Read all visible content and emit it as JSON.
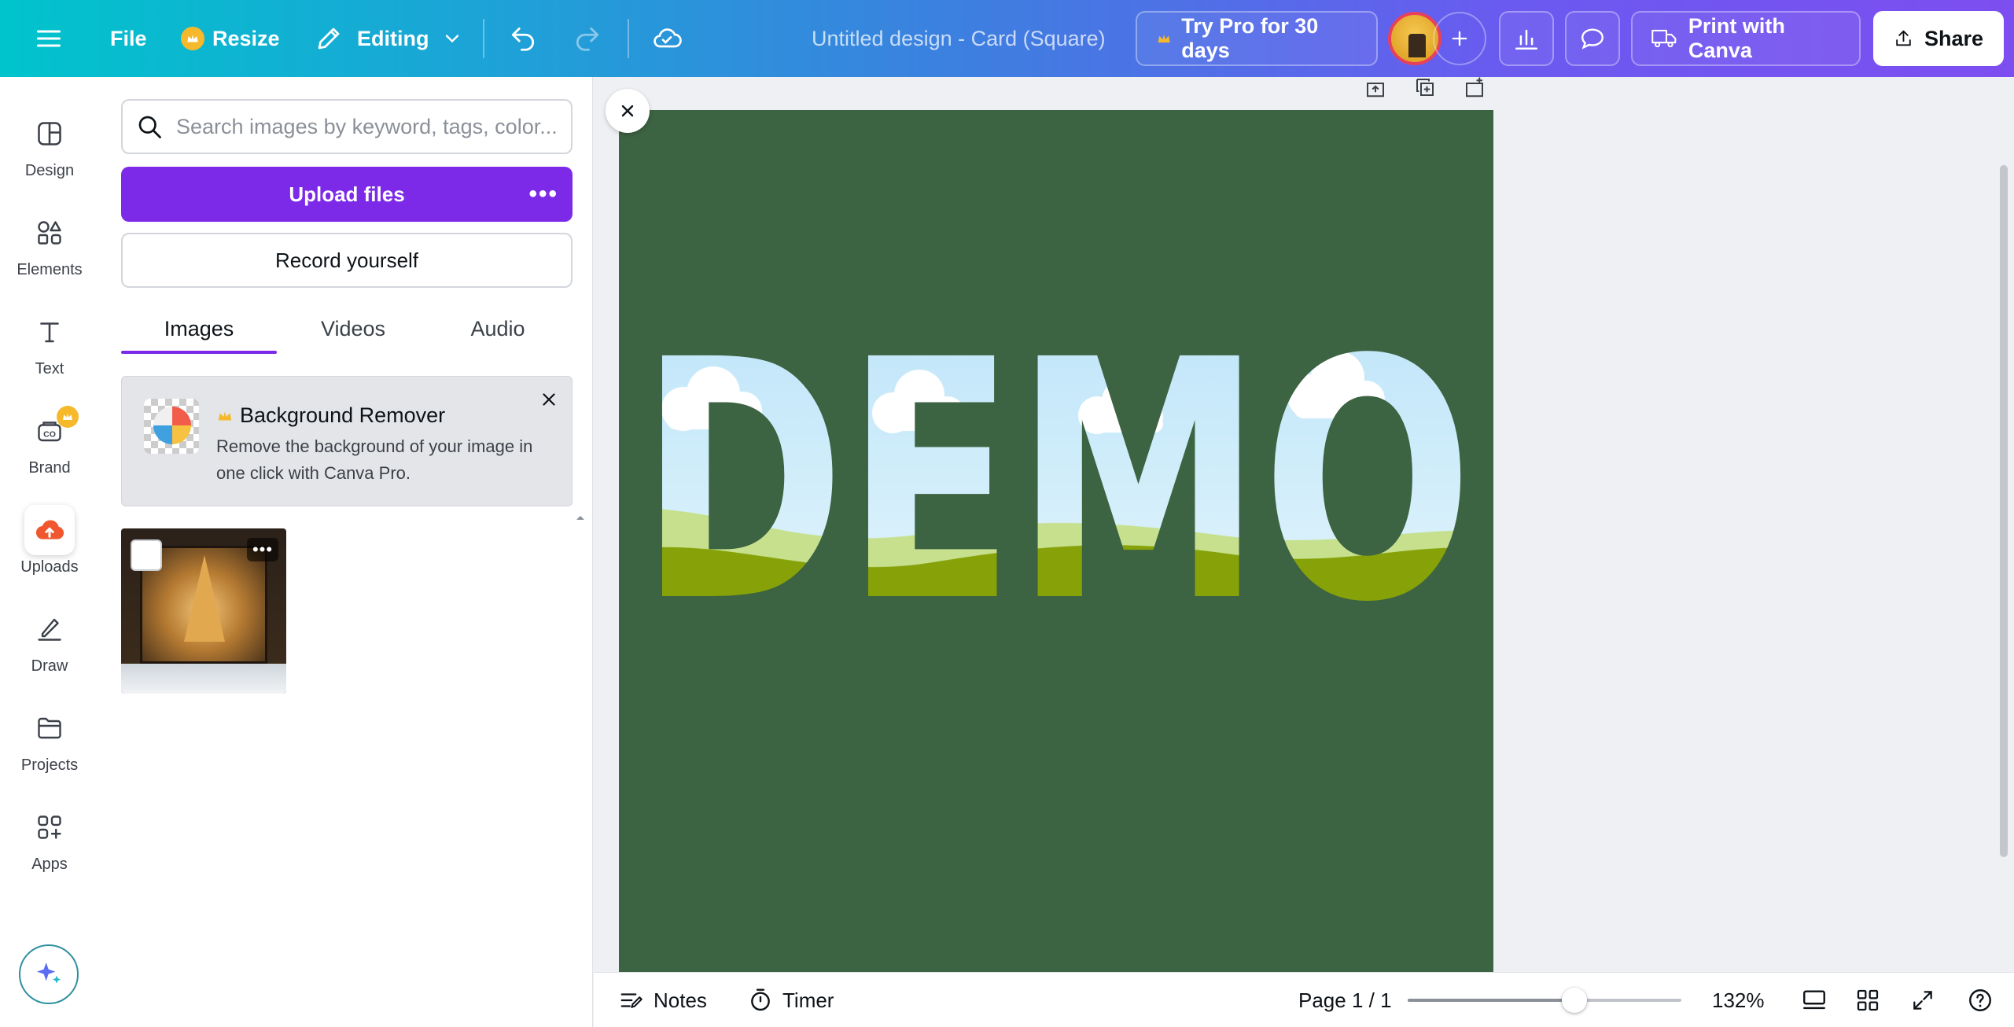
{
  "topbar": {
    "file_label": "File",
    "resize_label": "Resize",
    "editing_label": "Editing",
    "design_title": "Untitled design - Card (Square)",
    "try_pro_label": "Try Pro for 30 days",
    "print_label": "Print with Canva",
    "share_label": "Share",
    "icons": [
      "menu-icon",
      "crown-icon",
      "pencil-icon",
      "chevron-down-icon",
      "undo-icon",
      "redo-icon",
      "cloud-check-icon",
      "plus-icon",
      "analytics-icon",
      "comment-icon",
      "truck-icon",
      "share-upload-icon"
    ]
  },
  "rail": {
    "items": [
      {
        "label": "Design",
        "icon": "layout-icon"
      },
      {
        "label": "Elements",
        "icon": "shapes-icon"
      },
      {
        "label": "Text",
        "icon": "text-icon"
      },
      {
        "label": "Brand",
        "icon": "brand-icon"
      },
      {
        "label": "Uploads",
        "icon": "upload-cloud-icon"
      },
      {
        "label": "Draw",
        "icon": "draw-icon"
      },
      {
        "label": "Projects",
        "icon": "folder-icon"
      },
      {
        "label": "Apps",
        "icon": "apps-icon"
      }
    ],
    "active": "Uploads",
    "magic_icon": "sparkle-icon"
  },
  "panel": {
    "search_placeholder": "Search images by keyword, tags, color...",
    "upload_label": "Upload files",
    "record_label": "Record yourself",
    "tabs": [
      {
        "label": "Images",
        "active": true
      },
      {
        "label": "Videos",
        "active": false
      },
      {
        "label": "Audio",
        "active": false
      }
    ],
    "promo": {
      "title": "Background Remover",
      "description": "Remove the background of your image in one click with Canva Pro."
    }
  },
  "canvas": {
    "page_color": "#3c6342",
    "demo_text": "DEMO"
  },
  "bottombar": {
    "notes_label": "Notes",
    "timer_label": "Timer",
    "page_indicator": "Page 1 / 1",
    "zoom_label": "132%",
    "zoom_fraction": 0.61
  },
  "colors": {
    "brand_purple": "#7d2ae8",
    "gradient_start": "#00c4cc",
    "gradient_end": "#7d4ef0",
    "crown": "#f5b92b"
  }
}
